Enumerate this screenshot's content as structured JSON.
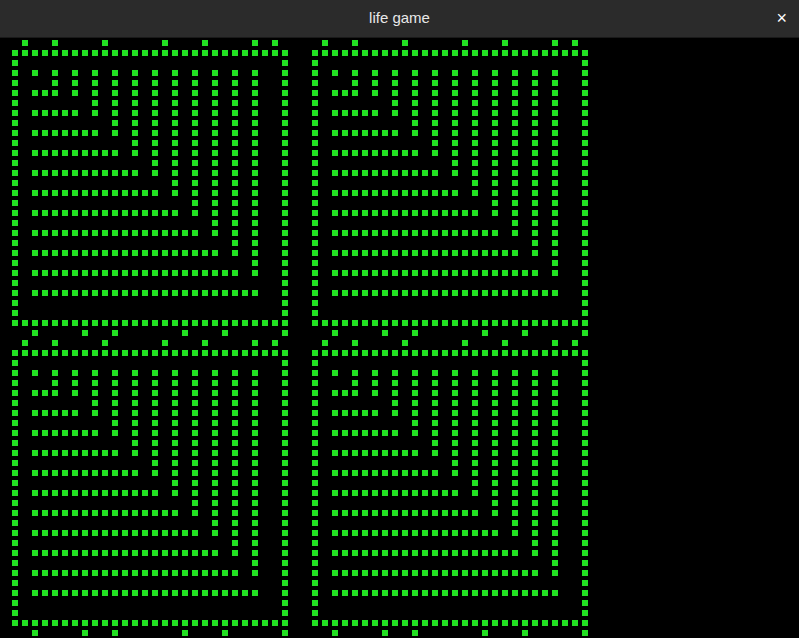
{
  "window": {
    "title": "life game",
    "close": "×"
  },
  "board": {
    "tile": [
      "..#..#....#.....#...#....#.#..",
      ".############################.",
      ".#..........................#.",
      ".#.#.#.#.#.#.#.#.#.#.#.#.#..#.",
      ".#...#.#.#.#.#.#.#.#.#.#.#..#.",
      ".#.###.#.#.#.#.#.#.#.#.#.#..#.",
      ".#.......#.#.#.#.#.#.#.#.#..#.",
      ".#.#####.#.#.#.#.#.#.#.#.#..#.",
      ".#.........#.#.#.#.#.#.#.#..#.",
      ".#.#######.#.#.#.#.#.#.#.#..#.",
      ".#...........#.#.#.#.#.#.#..#.",
      ".#.#########.#.#.#.#.#.#.#..#.",
      ".#.............#.#.#.#.#.#..#.",
      ".#.###########.#.#.#.#.#.#..#.",
      ".#...............#.#.#.#.#..#.",
      ".#.#############.#.#.#.#.#..#.",
      ".#.................#.#.#.#..#.",
      ".#.###############.#.#.#.#..#.",
      ".#...................#.#.#..#.",
      ".#.#################.#.#.#..#.",
      ".#.....................#.#..#.",
      ".#.###################.#.#..#.",
      ".#.......................#..#.",
      ".#.#####################.#..#.",
      ".#..........................#.",
      ".#.#######################..#.",
      ".#..........................#.",
      ".#..........................#.",
      ".############################.",
      "...#....#..#......#...#.....#."
    ]
  }
}
